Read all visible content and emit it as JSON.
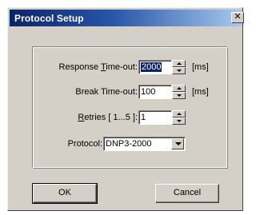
{
  "window": {
    "title": "Protocol Setup",
    "close_glyph": "✕"
  },
  "form": {
    "response_timeout": {
      "label_pre": "Response ",
      "label_ul": "T",
      "label_post": "ime-out:",
      "value": "2000",
      "unit": "[ms]"
    },
    "break_timeout": {
      "label": "Break Time-out:",
      "value": "100",
      "unit": "[ms]"
    },
    "retries": {
      "label_ul": "R",
      "label_post": "etries [ 1...5 ]:",
      "value": "1"
    },
    "protocol": {
      "label": "Protocol:",
      "value": "DNP3-2000"
    }
  },
  "buttons": {
    "ok": "OK",
    "cancel": "Cancel"
  },
  "colors": {
    "face": "#d4d0c8",
    "title_start": "#0a246a",
    "title_end": "#a6caf0",
    "selection": "#0a246a"
  },
  "icons": [
    "close-icon",
    "spin-up-arrow-icon",
    "spin-down-arrow-icon",
    "dropdown-arrow-icon"
  ]
}
